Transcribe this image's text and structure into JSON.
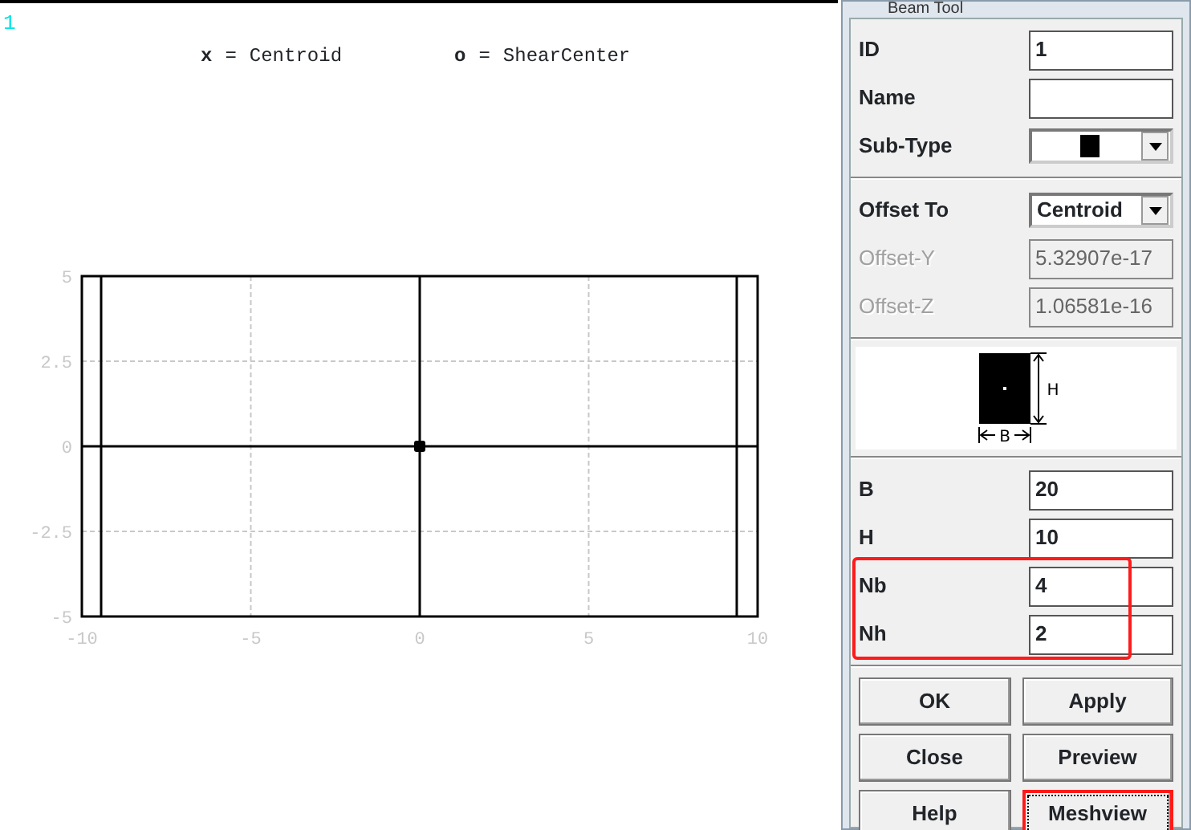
{
  "viewport": {
    "label": "1"
  },
  "legend": [
    {
      "symbol": "x",
      "separator": "=",
      "label": "Centroid"
    },
    {
      "symbol": "o",
      "separator": "="
    }
  ],
  "plot": {
    "chart_data": {
      "type": "scatter",
      "grid": true,
      "xlim": [
        -10,
        10
      ],
      "ylim": [
        -5,
        5
      ],
      "xticks": [
        -10,
        -5,
        0,
        5,
        10
      ],
      "yticks": [
        -5,
        -2.5,
        0,
        2.5,
        5
      ],
      "x": [
        0
      ],
      "series": [
        {
          "name": "ShearCenter",
          "color": "#000000",
          "values": [
            0
          ]
        }
      ]
    }
  },
  "dialog": {
    "title": "Beam Tool",
    "sections": [
      {
        "fields": [
          {
            "kind": "text",
            "label": "ID",
            "value": "1",
            "disabled": false
          },
          {
            "kind": "text",
            "label": "Name",
            "disabled": false
          },
          {
            "kind": "shape-select",
            "label": "Sub-Type",
            "disabled": false
          }
        ]
      },
      {
        "fields": [
          {
            "kind": "select",
            "label": "Offset To",
            "value": "Centroid",
            "disabled": false
          },
          {
            "kind": "text",
            "label": "Offset-Y",
            "value": "5.32907e-17",
            "disabled": true
          },
          {
            "kind": "text",
            "label": "Offset-Z",
            "value": "1.06581e-16",
            "disabled": true
          }
        ]
      },
      {
        "kind": "diagram",
        "width_label": "B",
        "height_label": "H"
      },
      {
        "fields": [
          {
            "kind": "text",
            "label": "B",
            "value": "20",
            "disabled": false
          },
          {
            "kind": "text",
            "label": "H",
            "value": "10",
            "disabled": false
          }
        ],
        "group": {
          "highlighted": true,
          "fields": [
            {
              "kind": "text",
              "label": "Nb",
              "value": "4",
              "disabled": false
            },
            {
              "kind": "text",
              "label": "Nh",
              "value": "2",
              "disabled": false
            }
          ]
        }
      }
    ],
    "buttons": [
      {
        "label": "OK",
        "focused": false,
        "highlighted": false
      },
      {
        "label": "Apply",
        "focused": false,
        "highlighted": false
      },
      {
        "label": "Close",
        "focused": false,
        "highlighted": false
      },
      {
        "label": "Preview",
        "focused": false,
        "highlighted": false
      },
      {
        "label": "Help",
        "focused": false,
        "highlighted": false
      },
      {
        "label": "Meshview",
        "focused": true,
        "highlighted": true
      }
    ]
  }
}
